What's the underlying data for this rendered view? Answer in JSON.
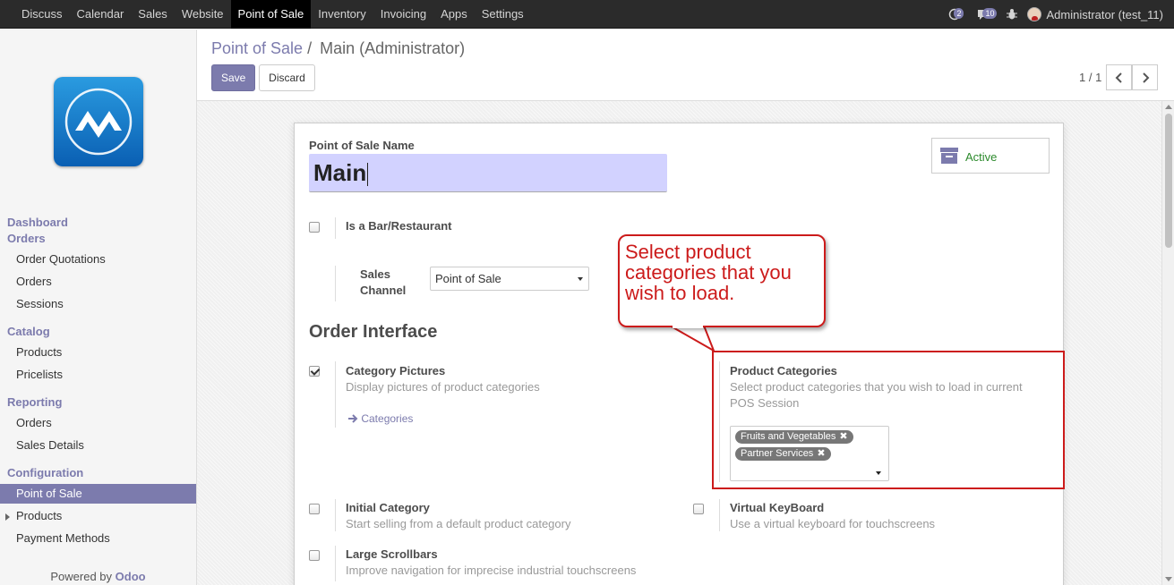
{
  "topbar": {
    "menu": [
      "Discuss",
      "Calendar",
      "Sales",
      "Website",
      "Point of Sale",
      "Inventory",
      "Invoicing",
      "Apps",
      "Settings"
    ],
    "active_menu": "Point of Sale",
    "messages_count": "2",
    "notifications_count": "10",
    "user": "Administrator (test_11)"
  },
  "sidebar": {
    "dashboard": "Dashboard",
    "orders_h": "Orders",
    "order_quotations": "Order Quotations",
    "orders": "Orders",
    "sessions": "Sessions",
    "catalog_h": "Catalog",
    "products": "Products",
    "pricelists": "Pricelists",
    "reporting_h": "Reporting",
    "rep_orders": "Orders",
    "sales_details": "Sales Details",
    "configuration_h": "Configuration",
    "point_of_sale": "Point of Sale",
    "conf_products": "Products",
    "payment_methods": "Payment Methods",
    "powered_by": "Powered by",
    "powered_brand": "Odoo"
  },
  "control_panel": {
    "breadcrumb_parent": "Point of Sale",
    "breadcrumb_sep": "/",
    "breadcrumb_current": "Main (Administrator)",
    "save": "Save",
    "discard": "Discard",
    "pager": "1 / 1"
  },
  "form": {
    "name_label": "Point of Sale Name",
    "name_value": "Main",
    "active_label": "Active",
    "bar_restaurant": "Is a Bar/Restaurant",
    "sales_channel_label_1": "Sales",
    "sales_channel_label_2": "Channel",
    "sales_channel_value": "Point of Sale",
    "order_interface": "Order Interface",
    "category_pictures": "Category Pictures",
    "category_pictures_help": "Display pictures of product categories",
    "categories_link": "Categories",
    "product_categories": "Product Categories",
    "product_categories_help_1": "Select product categories that you wish to load in current",
    "product_categories_help_2": "POS Session",
    "tags": [
      "Fruits and Vegetables",
      "Partner Services"
    ],
    "initial_category": "Initial Category",
    "initial_category_help": "Start selling from a default product category",
    "virtual_keyboard": "Virtual KeyBoard",
    "virtual_keyboard_help": "Use a virtual keyboard for touchscreens",
    "large_scrollbars": "Large Scrollbars",
    "large_scrollbars_help": "Improve navigation for imprecise industrial touchscreens",
    "category_pictures_checked": true
  },
  "annotation": {
    "callout_line_1": "Select product",
    "callout_line_2": "categories that you",
    "callout_line_3": "wish to load.",
    "color": "#cc1b1b"
  }
}
